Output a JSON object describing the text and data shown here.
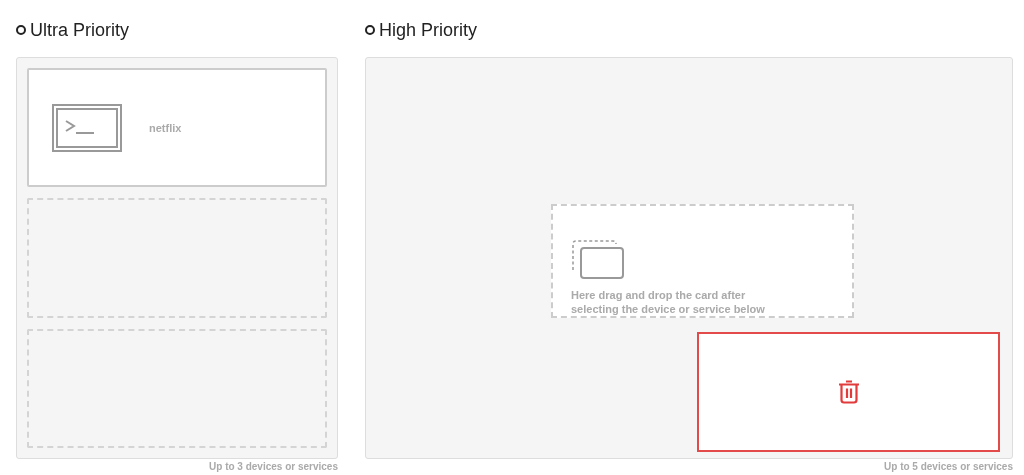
{
  "sections": [
    {
      "title": "Ultra Priority",
      "slots": [
        {
          "kind": "device",
          "label": "netflix"
        },
        {
          "kind": "empty"
        },
        {
          "kind": "empty"
        }
      ],
      "limit": "Up to 3 devices or services"
    },
    {
      "title": "High Priority",
      "drop_hint": "Here drag and drop the card after selecting the device or service below",
      "delete_zone": {
        "highlighted": true
      },
      "limit": "Up to 5 devices or services"
    }
  ]
}
